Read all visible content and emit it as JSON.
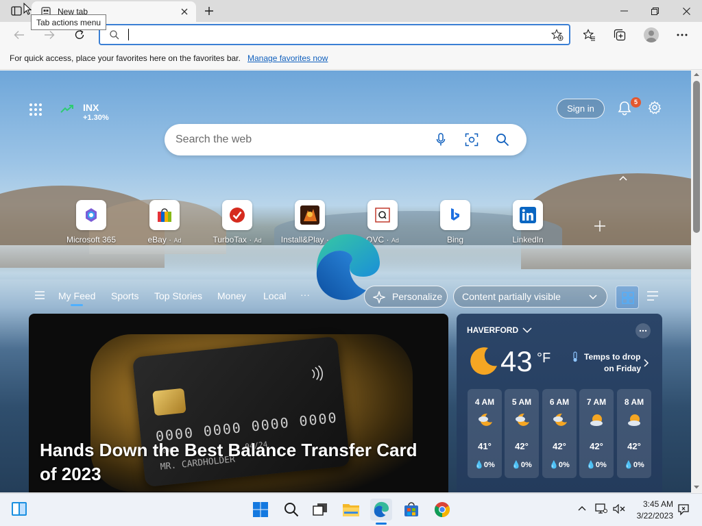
{
  "browser": {
    "tab": {
      "title": "New tab"
    },
    "tooltip": "Tab actions menu",
    "address_bar": {
      "value": "",
      "placeholder": ""
    },
    "favorites_bar": {
      "message": "For quick access, place your favorites here on the favorites bar.",
      "link": "Manage favorites now"
    }
  },
  "newtab": {
    "stock": {
      "symbol": "INX",
      "change": "+1.30%"
    },
    "sign_in": "Sign in",
    "notifications_count": "5",
    "search": {
      "placeholder": "Search the web"
    },
    "quick_links": [
      {
        "label": "Microsoft 365",
        "ad": ""
      },
      {
        "label": "eBay",
        "ad": "Ad"
      },
      {
        "label": "TurboTax",
        "ad": "Ad"
      },
      {
        "label": "Install&Play",
        "ad": "Ad"
      },
      {
        "label": "QVC",
        "ad": "Ad"
      },
      {
        "label": "Bing",
        "ad": ""
      },
      {
        "label": "LinkedIn",
        "ad": ""
      }
    ],
    "feed_tabs": [
      "My Feed",
      "Sports",
      "Top Stories",
      "Money",
      "Local"
    ],
    "more": "···",
    "personalize": "Personalize",
    "content_visibility": "Content partially visible",
    "hero": {
      "title": "Hands Down the Best Balance Transfer Card of 2023",
      "card_number": "0000 0000 0000 0000",
      "card_small": "0000",
      "card_holder": "MR. CARDHOLDER",
      "card_expiry": "04/24"
    },
    "weather": {
      "location": "HAVERFORD",
      "temp": "43",
      "unit": "°F",
      "alert_line1": "Temps to drop",
      "alert_line2": "on Friday",
      "hourly": [
        {
          "time": "4 AM",
          "temp": "41°",
          "precip": "0%"
        },
        {
          "time": "5 AM",
          "temp": "42°",
          "precip": "0%"
        },
        {
          "time": "6 AM",
          "temp": "42°",
          "precip": "0%"
        },
        {
          "time": "7 AM",
          "temp": "42°",
          "precip": "0%"
        },
        {
          "time": "8 AM",
          "temp": "42°",
          "precip": "0%"
        }
      ]
    }
  },
  "taskbar": {
    "time": "3:45 AM",
    "date": "3/22/2023"
  },
  "colors": {
    "accent": "#0f5fbd",
    "stock_up": "#2ecc71",
    "badge": "#e4572e"
  }
}
